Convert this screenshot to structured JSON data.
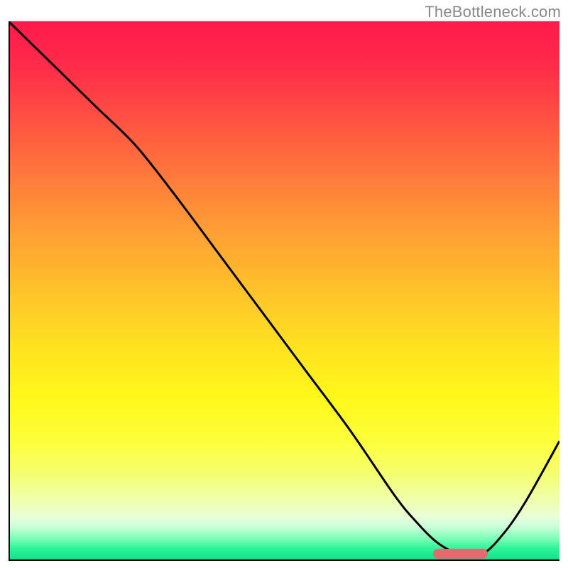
{
  "watermark": {
    "text": "TheBottleneck.com"
  },
  "colors": {
    "curve": "#000000",
    "marker": "#e46a6f",
    "axis": "#000000",
    "gradient_top": "#ff1a4b",
    "gradient_mid": "#ffe120",
    "gradient_bottom": "#11e28a"
  },
  "chart_data": {
    "type": "line",
    "title": "",
    "xlabel": "",
    "ylabel": "",
    "xlim": [
      0,
      100
    ],
    "ylim": [
      0,
      100
    ],
    "grid": false,
    "legend": false,
    "series": [
      {
        "name": "bottleneck-curve",
        "x": [
          0,
          8,
          16,
          23,
          30,
          38,
          46,
          54,
          62,
          70,
          74,
          78,
          82,
          86,
          90,
          94,
          100
        ],
        "values": [
          100,
          92,
          84,
          77,
          68,
          57,
          46,
          35,
          24,
          12,
          7,
          3,
          1,
          1,
          5,
          11,
          22
        ]
      }
    ],
    "marker": {
      "x_start": 77,
      "x_end": 87,
      "y": 1
    },
    "annotations": []
  }
}
